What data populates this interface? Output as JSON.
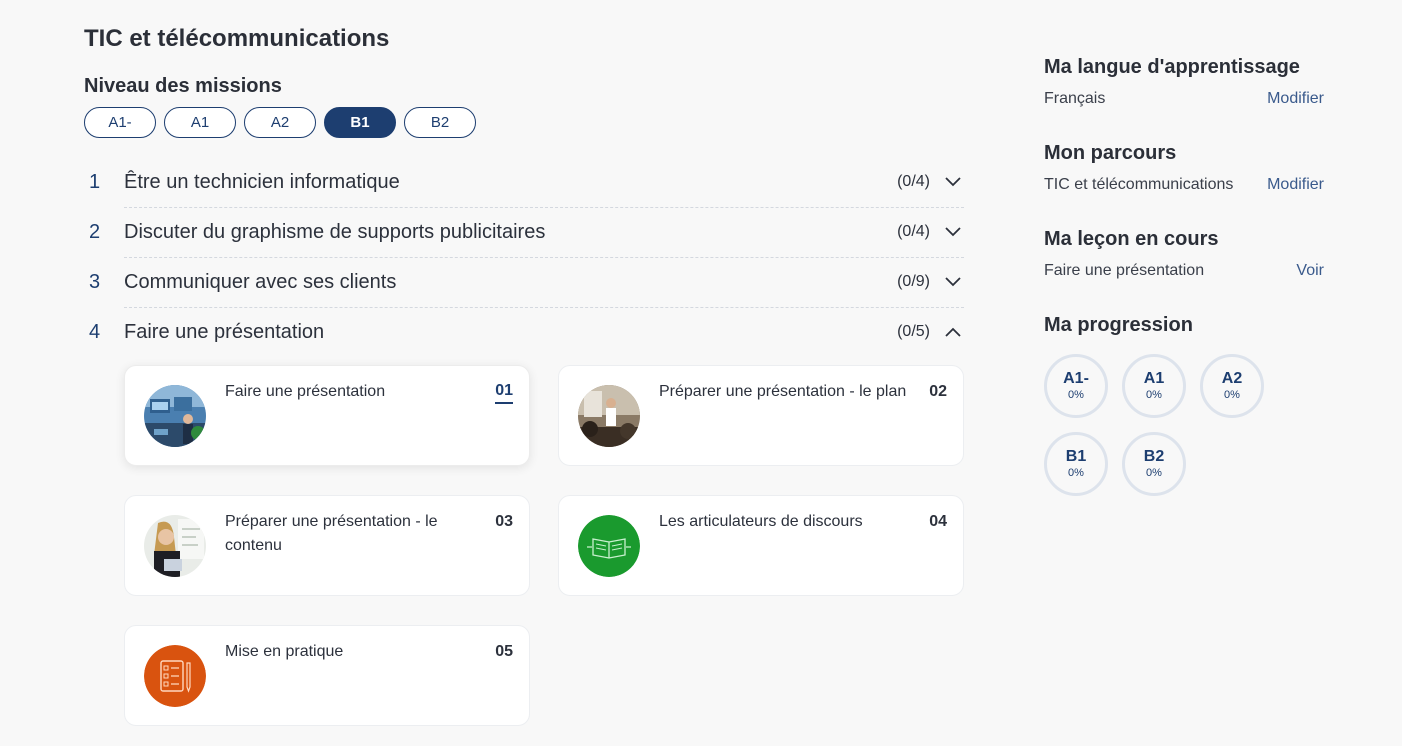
{
  "page": {
    "title": "TIC et télécommunications",
    "levels_heading": "Niveau des missions",
    "levels": [
      "A1-",
      "A1",
      "A2",
      "B1",
      "B2"
    ],
    "active_level": "B1"
  },
  "missions": [
    {
      "number": "1",
      "label": "Être un technicien informatique",
      "count": "(0/4)",
      "expanded": false
    },
    {
      "number": "2",
      "label": "Discuter du graphisme de supports publicitaires",
      "count": "(0/4)",
      "expanded": false
    },
    {
      "number": "3",
      "label": "Communiquer avec ses clients",
      "count": "(0/9)",
      "expanded": false
    },
    {
      "number": "4",
      "label": "Faire une présentation",
      "count": "(0/5)",
      "expanded": true
    }
  ],
  "lessons": [
    {
      "title": "Faire une présentation",
      "index": "01",
      "icon": "presentation-photo"
    },
    {
      "title": "Préparer une présentation - le plan",
      "index": "02",
      "icon": "speaker-photo"
    },
    {
      "title": "Préparer une présentation - le contenu",
      "index": "03",
      "icon": "whiteboard-photo"
    },
    {
      "title": "Les articulateurs de discours",
      "index": "04",
      "icon": "open-book-icon"
    },
    {
      "title": "Mise en pratique",
      "index": "05",
      "icon": "checklist-icon"
    }
  ],
  "sidebar": {
    "language": {
      "heading": "Ma langue d'apprentissage",
      "value": "Français",
      "action": "Modifier"
    },
    "path": {
      "heading": "Mon parcours",
      "value": "TIC et télécommunications",
      "action": "Modifier"
    },
    "lesson": {
      "heading": "Ma leçon en cours",
      "value": "Faire une présentation",
      "action": "Voir"
    },
    "progress": {
      "heading": "Ma progression",
      "items": [
        {
          "level": "A1-",
          "percent": "0%"
        },
        {
          "level": "A1",
          "percent": "0%"
        },
        {
          "level": "A2",
          "percent": "0%"
        },
        {
          "level": "B1",
          "percent": "0%"
        },
        {
          "level": "B2",
          "percent": "0%"
        }
      ]
    }
  },
  "colors": {
    "primary": "#1d3e70",
    "link": "#3a5a8c",
    "background": "#f8f8f8",
    "green_icon": "#1a9a2e",
    "orange_icon": "#d9530f"
  }
}
